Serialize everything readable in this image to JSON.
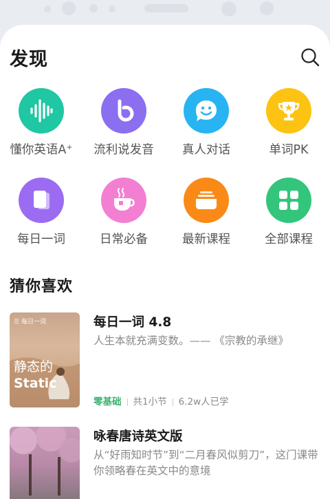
{
  "header": {
    "title": "发现"
  },
  "grid": [
    {
      "label": "懂你英语A⁺",
      "icon": "waveform-icon",
      "color": "#1fc7a3"
    },
    {
      "label": "流利说发音",
      "icon": "pronounce-icon",
      "color": "#8b6ff0"
    },
    {
      "label": "真人对话",
      "icon": "chat-face-icon",
      "color": "#28b4f2"
    },
    {
      "label": "单词PK",
      "icon": "trophy-icon",
      "color": "#fdc312"
    },
    {
      "label": "每日一词",
      "icon": "cards-icon",
      "color": "#9b6cf2"
    },
    {
      "label": "日常必备",
      "icon": "teacup-icon",
      "color": "#f27fd2"
    },
    {
      "label": "最新课程",
      "icon": "course-stack-icon",
      "color": "#fa8a18"
    },
    {
      "label": "全部课程",
      "icon": "grid-apps-icon",
      "color": "#33c57c"
    }
  ],
  "section": {
    "title": "猜你喜欢"
  },
  "courses": [
    {
      "title": "每日一词 4.8",
      "desc": "人生本就充满变数。—— 《宗教的承继》",
      "level": "零基础",
      "sections": "共1小节",
      "learners": "6.2w人已学",
      "thumb_tag": "每日一词",
      "thumb_cn": "静态的",
      "thumb_en": "Static"
    },
    {
      "title": "咏春唐诗英文版",
      "desc": "从“好雨知时节”到“二月春风似剪刀”，这门课带你领略春在英文中的意境"
    }
  ]
}
